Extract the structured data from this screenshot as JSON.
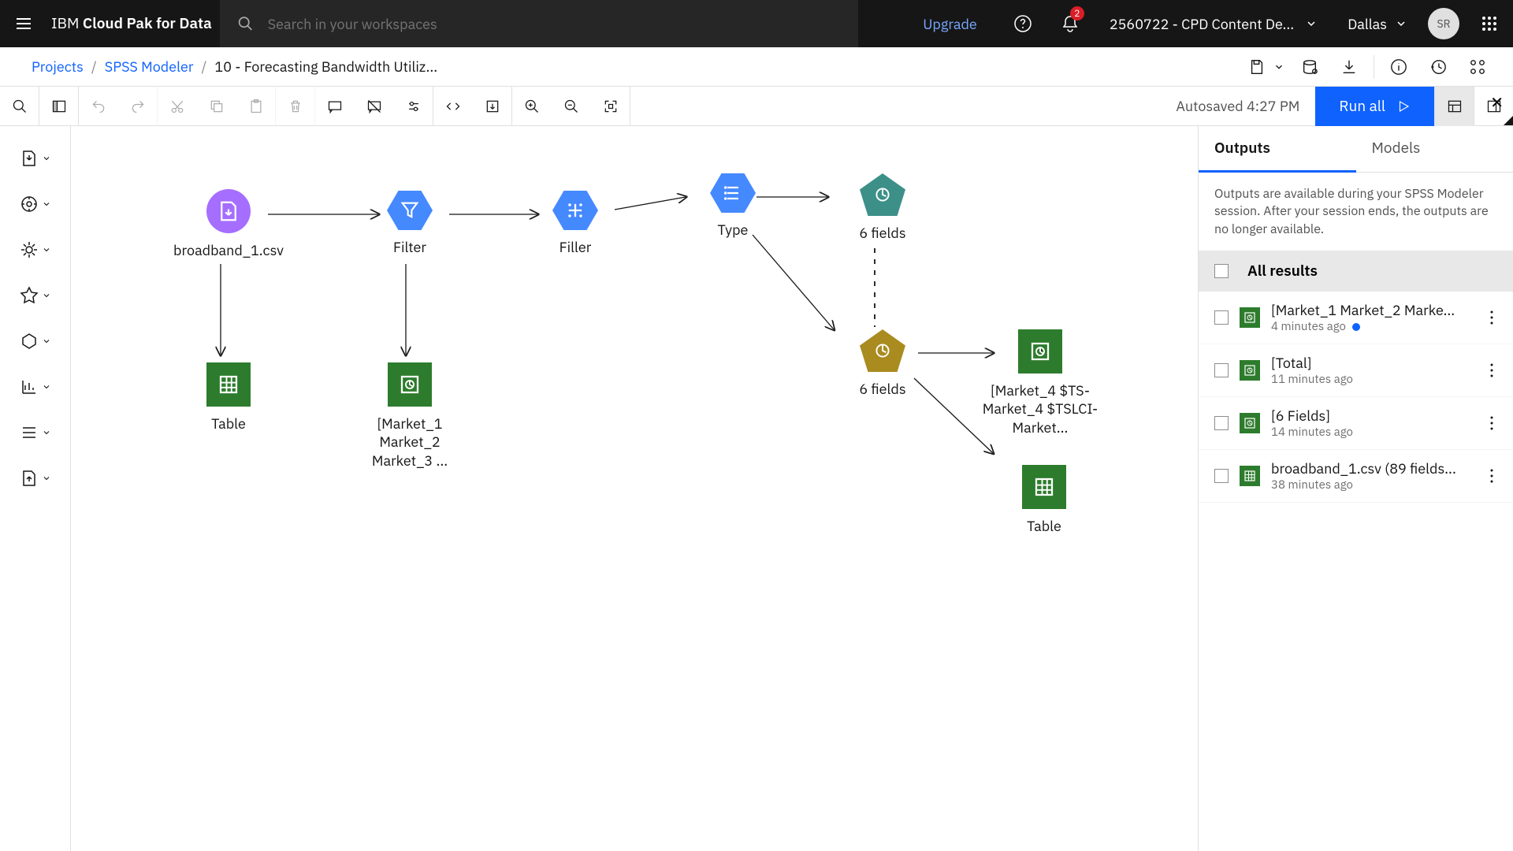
{
  "header": {
    "brand_prefix": "IBM",
    "brand_name": "Cloud Pak for Data",
    "search_placeholder": "Search in your workspaces",
    "upgrade": "Upgrade",
    "notif_count": "2",
    "account": "2560722 - CPD Content De...",
    "region": "Dallas",
    "avatar_initials": "SR"
  },
  "breadcrumb": {
    "projects": "Projects",
    "spss": "SPSS Modeler",
    "current": "10 - Forecasting Bandwidth Utiliz..."
  },
  "toolbar": {
    "autosave": "Autosaved 4:27 PM",
    "run_all": "Run all"
  },
  "nodes": {
    "source": "broadband_1.csv",
    "filter": "Filter",
    "filler": "Filler",
    "type": "Type",
    "fields_top": "6 fields",
    "fields_mid": "6 fields",
    "table1": "Table",
    "market_plot": "[Market_1 Market_2 Market_3 ...",
    "ts_plot": "[Market_4 $TS-Market_4 $TSLCI-Market...",
    "table2": "Table"
  },
  "panel": {
    "tab_outputs": "Outputs",
    "tab_models": "Models",
    "note": "Outputs are available during your SPSS Modeler session. After your session ends, the outputs are no longer available.",
    "all_results": "All results",
    "rows": [
      {
        "title": "[Market_1 Market_2 Marke...",
        "time": "4 minutes ago",
        "new": true,
        "icon": "chart"
      },
      {
        "title": "[Total]",
        "time": "11 minutes ago",
        "new": false,
        "icon": "chart"
      },
      {
        "title": "[6 Fields]",
        "time": "14 minutes ago",
        "new": false,
        "icon": "chart"
      },
      {
        "title": "broadband_1.csv (89 fields...",
        "time": "38 minutes ago",
        "new": false,
        "icon": "table"
      }
    ]
  }
}
